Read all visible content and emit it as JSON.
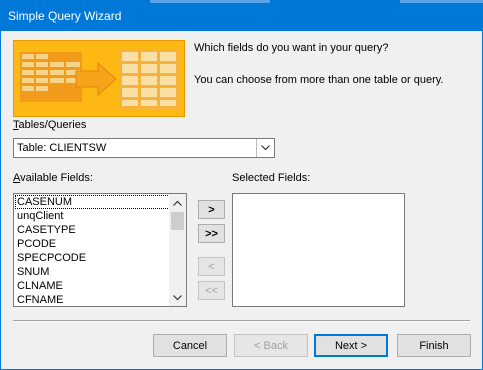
{
  "window": {
    "title": "Simple Query Wizard"
  },
  "prompts": {
    "question": "Which fields do you want in your query?",
    "hint": "You can choose from more than one table or query."
  },
  "tables_queries": {
    "label": "Tables/Queries",
    "accel": "T",
    "rest": "ables/Queries",
    "selected": "Table: CLIENTSW"
  },
  "available_fields": {
    "label": "Available Fields:",
    "accel": "A",
    "rest": "vailable Fields:",
    "items": [
      "CASENUM",
      "unqClient",
      "CASETYPE",
      "PCODE",
      "SPECPCODE",
      "SNUM",
      "CLNAME",
      "CFNAME"
    ],
    "selected_item": "CASENUM"
  },
  "selected_fields": {
    "label": "Selected Fields:",
    "items": []
  },
  "move_buttons": {
    "add_one": ">",
    "add_all": ">>",
    "remove_one": "<",
    "remove_all": "<<"
  },
  "buttons": {
    "cancel": "Cancel",
    "back": "< Back",
    "next": "Next >",
    "finish": "Finish"
  },
  "colors": {
    "titlebar": "#0078d7",
    "banner": "#fdb813"
  },
  "icons": {
    "banner": "wizard-table-transfer-icon",
    "combo_arrow": "chevron-down-icon",
    "scroll_up": "scroll-up-icon",
    "scroll_down": "scroll-down-icon"
  }
}
